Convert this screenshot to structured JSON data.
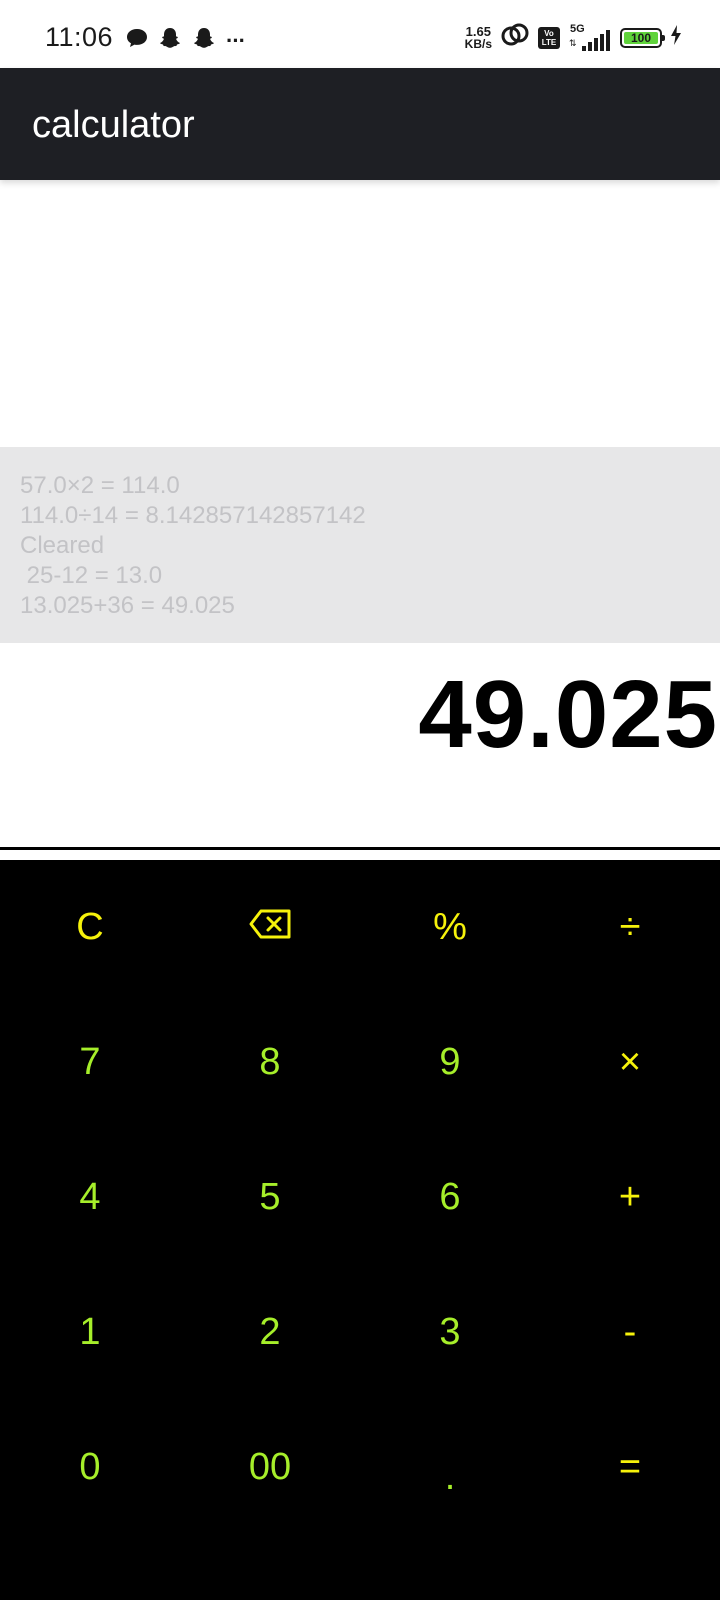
{
  "status_bar": {
    "time": "11:06",
    "net_speed_value": "1.65",
    "net_speed_unit": "KB/s",
    "volte_top": "Vo",
    "volte_bottom": "LTE",
    "network": "5G",
    "battery": "100",
    "more": "···"
  },
  "app_bar": {
    "title": "calculator"
  },
  "history": [
    "57.0×2 = 114.0",
    "114.0÷14 = 8.142857142857142",
    "Cleared",
    " 25-12 = 13.0",
    "13.025+36 = 49.025"
  ],
  "result": "49.025",
  "keys": {
    "clear": "C",
    "percent": "%",
    "divide": "÷",
    "seven": "7",
    "eight": "8",
    "nine": "9",
    "multiply": "×",
    "four": "4",
    "five": "5",
    "six": "6",
    "plus": "+",
    "one": "1",
    "two": "2",
    "three": "3",
    "minus": "-",
    "zero": "0",
    "double_zero": "00",
    "decimal": ".",
    "equals": "="
  },
  "colors": {
    "digit_key": "#a6ee2a",
    "operator_key": "#f6f20b",
    "keypad_bg": "#000000",
    "app_bar_bg": "#1e1f24",
    "history_bg": "#e7e7e8",
    "history_text": "#c3c3c6"
  },
  "icons": {
    "backspace": "backspace-icon",
    "chat": "chat-bubble-icon",
    "snapchat": "snapchat-ghost-icon",
    "link": "link-icon",
    "charging": "charging-bolt-icon"
  }
}
